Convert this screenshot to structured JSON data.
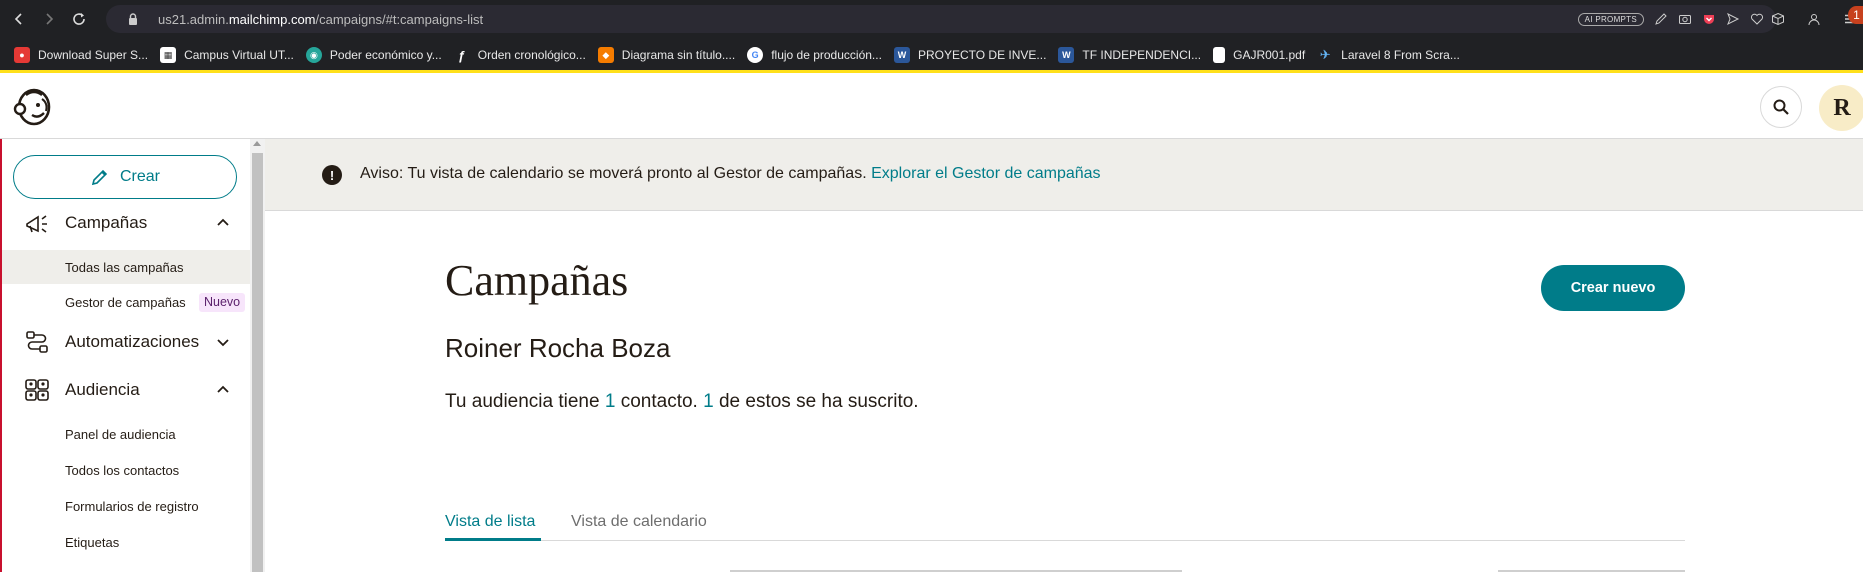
{
  "browser": {
    "url_prefix": "us21.admin.",
    "url_domain": "mailchimp.com",
    "url_path": "/campaigns/#t:campaigns-list",
    "ai_prompts_label": "AI PROMPTS"
  },
  "bookmarks": [
    {
      "label": "Download Super S...",
      "icon_color": "#e53935",
      "icon_char": "●"
    },
    {
      "label": "Campus Virtual UT...",
      "icon_color": "#ffffff",
      "icon_char": "▦"
    },
    {
      "label": "Poder económico y...",
      "icon_color": "#26a69a",
      "icon_char": "◉"
    },
    {
      "label": "Orden cronológico...",
      "icon_color": "#ffffff",
      "icon_char": "ƒ"
    },
    {
      "label": "Diagrama sin título....",
      "icon_color": "#f57c00",
      "icon_char": "◆"
    },
    {
      "label": "flujo de producción...",
      "icon_color": "#4285f4",
      "icon_char": "G"
    },
    {
      "label": "PROYECTO DE INVE...",
      "icon_color": "#2b579a",
      "icon_char": "W"
    },
    {
      "label": "TF INDEPENDENCI...",
      "icon_color": "#2b579a",
      "icon_char": "W"
    },
    {
      "label": "GAJR001.pdf",
      "icon_color": "#ffffff",
      "icon_char": "▮"
    },
    {
      "label": "Laravel 8 From Scra...",
      "icon_color": "#64b5f6",
      "icon_char": "✈"
    }
  ],
  "header": {
    "avatar_initial": "R",
    "notification_count": "1"
  },
  "sidebar": {
    "create_label": "Crear",
    "sections": [
      {
        "label": "Campañas",
        "items": [
          "Todas las campañas",
          "Gestor de campañas"
        ],
        "new_badge": "Nuevo"
      },
      {
        "label": "Automatizaciones"
      },
      {
        "label": "Audiencia",
        "items": [
          "Panel de audiencia",
          "Todos los contactos",
          "Formularios de registro",
          "Etiquetas"
        ]
      }
    ]
  },
  "alert": {
    "text": "Aviso: Tu vista de calendario se moverá pronto al Gestor de campañas.",
    "link": "Explorar el Gestor de campañas"
  },
  "main": {
    "title": "Campañas",
    "create_new_label": "Crear nuevo",
    "audience_name": "Roiner Rocha Boza",
    "summary_part1": "Tu audiencia tiene",
    "contacts_count": "1",
    "summary_part2": "contacto.",
    "subscribed_count": "1",
    "summary_part3": "de estos se ha suscrito.",
    "tabs": [
      "Vista de lista",
      "Vista de calendario"
    ]
  },
  "colors": {
    "accent": "#007c89",
    "brand_yellow": "#ffe01b",
    "alert_bg": "#efeeea"
  }
}
